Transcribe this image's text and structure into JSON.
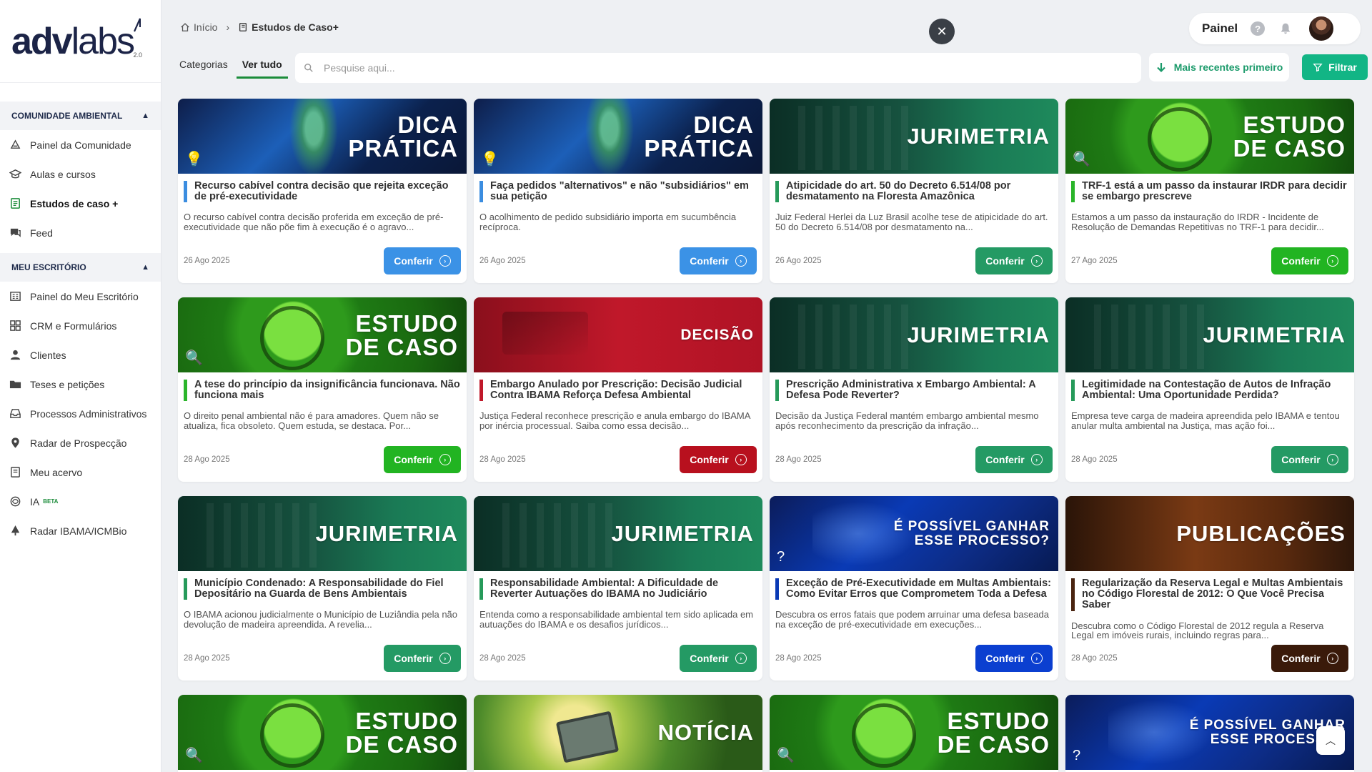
{
  "logo": {
    "main_a": "adv",
    "main_b": "labs",
    "version": "2.0"
  },
  "sidebar": {
    "sections": [
      {
        "label": "COMUNIDADE AMBIENTAL",
        "items": [
          {
            "label": "Painel da Comunidade",
            "icon": "community-icon"
          },
          {
            "label": "Aulas e cursos",
            "icon": "graduation-cap-icon"
          },
          {
            "label": "Estudos de caso +",
            "icon": "book-icon",
            "active": true
          },
          {
            "label": "Feed",
            "icon": "chat-icon"
          }
        ]
      },
      {
        "label": "MEU ESCRITÓRIO",
        "items": [
          {
            "label": "Painel do Meu Escritório",
            "icon": "building-icon"
          },
          {
            "label": "CRM e Formulários",
            "icon": "grid-icon"
          },
          {
            "label": "Clientes",
            "icon": "user-icon"
          },
          {
            "label": "Teses e petições",
            "icon": "folder-icon"
          },
          {
            "label": "Processos Administrativos",
            "icon": "inbox-icon"
          },
          {
            "label": "Radar de Prospecção",
            "icon": "map-pin-icon"
          },
          {
            "label": "Meu acervo",
            "icon": "archive-icon"
          },
          {
            "label": "IA",
            "icon": "ai-icon",
            "badge": "BETA"
          },
          {
            "label": "Radar IBAMA/ICMBio",
            "icon": "tree-icon"
          }
        ]
      }
    ]
  },
  "breadcrumb": {
    "home": "Início",
    "current": "Estudos de Caso+"
  },
  "header": {
    "panel_label": "Painel",
    "help": "?"
  },
  "tabs": [
    "Categorias",
    "Ver tudo"
  ],
  "search": {
    "placeholder": "Pesquise aqui..."
  },
  "sort": {
    "label": "Mais recentes primeiro"
  },
  "filter": {
    "label": "Filtrar"
  },
  "cards": [
    {
      "banner": "dica",
      "banner_lines": [
        "DICA",
        "PRÁTICA"
      ],
      "color": "#3b8de0",
      "title": "Recurso cabível contra decisão que rejeita exceção de pré-executividade",
      "desc": "O recurso cabível contra decisão proferida em exceção de pré-executividade que não põe fim à execução é o agravo...",
      "date": "26 Ago 2025",
      "button": "Conferir"
    },
    {
      "banner": "dica",
      "banner_lines": [
        "DICA",
        "PRÁTICA"
      ],
      "color": "#3b8de0",
      "title": "Faça pedidos \"alternativos\" e não \"subsidiários\" em sua petição",
      "desc": "O acolhimento de pedido subsidiário importa em sucumbência recíproca.",
      "date": "26 Ago 2025",
      "button": "Conferir"
    },
    {
      "banner": "juri",
      "banner_lines": [
        "JURIMETRIA"
      ],
      "color": "#269a5a",
      "title": "Atipicidade do art. 50 do Decreto 6.514/08 por desmatamento na Floresta Amazônica",
      "desc": "Juiz Federal Herlei da Luz Brasil acolhe tese de atipicidade do art. 50 do Decreto 6.514/08 por desmatamento na...",
      "date": "26 Ago 2025",
      "button": "Conferir"
    },
    {
      "banner": "estudo",
      "banner_lines": [
        "ESTUDO",
        "DE CASO"
      ],
      "color": "#2ab52a",
      "title": "TRF-1 está a um passo da instaurar IRDR para decidir se embargo prescreve",
      "desc": "Estamos a um passo da instauração do IRDR - Incidente de Resolução de Demandas Repetitivas no TRF-1 para decidir...",
      "date": "27 Ago 2025",
      "button": "Conferir"
    },
    {
      "banner": "estudo",
      "banner_lines": [
        "ESTUDO",
        "DE CASO"
      ],
      "color": "#2ab52a",
      "title": "A tese do princípio da insignificância funcionava. Não funciona mais",
      "desc": "O direito penal ambiental não é para amadores. Quem não se atualiza, fica obsoleto. Quem estuda, se destaca. Por...",
      "date": "28 Ago 2025",
      "button": "Conferir"
    },
    {
      "banner": "decisao",
      "banner_lines": [
        "DECISÃO"
      ],
      "color": "#c0182a",
      "title": "Embargo Anulado por Prescrição: Decisão Judicial Contra IBAMA Reforça Defesa Ambiental",
      "desc": "Justiça Federal reconhece prescrição e anula embargo do IBAMA por inércia processual. Saiba como essa decisão...",
      "date": "28 Ago 2025",
      "button": "Conferir"
    },
    {
      "banner": "juri",
      "banner_lines": [
        "JURIMETRIA"
      ],
      "color": "#269a5a",
      "title": "Prescrição Administrativa x Embargo Ambiental: A Defesa Pode Reverter?",
      "desc": "Decisão da Justiça Federal mantém embargo ambiental mesmo após reconhecimento da prescrição da infração...",
      "date": "28 Ago 2025",
      "button": "Conferir"
    },
    {
      "banner": "juri",
      "banner_lines": [
        "JURIMETRIA"
      ],
      "color": "#269a5a",
      "title": "Legitimidade na Contestação de Autos de Infração Ambiental: Uma Oportunidade Perdida?",
      "desc": "Empresa teve carga de madeira apreendida pelo IBAMA e tentou anular multa ambiental na Justiça, mas ação foi...",
      "date": "28 Ago 2025",
      "button": "Conferir"
    },
    {
      "banner": "juri",
      "banner_lines": [
        "JURIMETRIA"
      ],
      "color": "#269a5a",
      "title": "Município Condenado: A Responsabilidade do Fiel Depositário na Guarda de Bens Ambientais",
      "desc": "O IBAMA acionou judicialmente o Município de Luziândia pela não devolução de madeira apreendida. A revelia...",
      "date": "28 Ago 2025",
      "button": "Conferir"
    },
    {
      "banner": "juri",
      "banner_lines": [
        "JURIMETRIA"
      ],
      "color": "#269a5a",
      "title": "Responsabilidade Ambiental: A Dificuldade de Reverter Autuações do IBAMA no Judiciário",
      "desc": "Entenda como a responsabilidade ambiental tem sido aplicada em autuações do IBAMA e os desafios jurídicos...",
      "date": "28 Ago 2025",
      "button": "Conferir"
    },
    {
      "banner": "ganhar",
      "banner_lines": [
        "É POSSÍVEL GANHAR",
        "ESSE PROCESSO?"
      ],
      "color": "#0a3ab5",
      "title": "Exceção de Pré-Executividade em Multas Ambientais: Como Evitar Erros que Comprometem Toda a Defesa",
      "desc": "Descubra os erros fatais que podem arruinar uma defesa baseada na exceção de pré-executividade em execuções...",
      "date": "28 Ago 2025",
      "button": "Conferir"
    },
    {
      "banner": "pub",
      "banner_lines": [
        "PUBLICAÇÕES"
      ],
      "color": "#4a2410",
      "title": "Regularização da Reserva Legal e Multas Ambientais no Código Florestal de 2012: O Que Você Precisa Saber",
      "desc": "Descubra como o Código Florestal de 2012 regula a Reserva Legal em imóveis rurais, incluindo regras para...",
      "date": "28 Ago 2025",
      "button": "Conferir"
    },
    {
      "banner": "estudo",
      "banner_lines": [
        "ESTUDO",
        "DE CASO"
      ]
    },
    {
      "banner": "noticia",
      "banner_lines": [
        "NOTÍCIA"
      ]
    },
    {
      "banner": "estudo",
      "banner_lines": [
        "ESTUDO",
        "DE CASO"
      ]
    },
    {
      "banner": "ganhar",
      "banner_lines": [
        "É POSSÍVEL GANHAR",
        "ESSE PROCESSO?"
      ]
    }
  ],
  "button_colors": {
    "dica": "#3b92e6",
    "juri": "#249a64",
    "estudo": "#22b422",
    "decisao": "#b8101e",
    "ganhar": "#0b3fd0",
    "pub": "#3a1a0a"
  }
}
